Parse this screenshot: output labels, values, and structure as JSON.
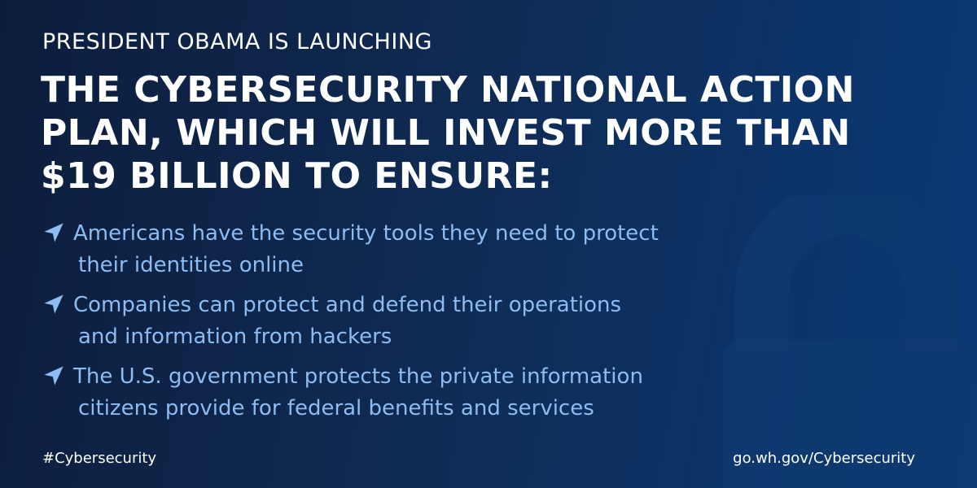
{
  "eyebrow": "PRESIDENT OBAMA IS LAUNCHING",
  "headline_lines": [
    "THE CYBERSECURITY NATIONAL ACTION",
    "PLAN, WHICH WILL INVEST MORE THAN",
    "$19 BILLION TO ENSURE:"
  ],
  "bullets": [
    {
      "icon": "navigation-arrow-icon",
      "lines": [
        "Americans have the security tools they need to protect",
        "their identities online"
      ]
    },
    {
      "icon": "navigation-arrow-icon",
      "lines": [
        "Companies can protect and defend their operations",
        "and information from hackers"
      ]
    },
    {
      "icon": "navigation-arrow-icon",
      "lines": [
        "The U.S. government protects the private information",
        "citizens provide for federal benefits and services"
      ]
    }
  ],
  "footer": {
    "hashtag": "#Cybersecurity",
    "url": "go.wh.gov/Cybersecurity"
  },
  "background_icon": "padlock-icon",
  "colors": {
    "background_dark": "#0c1d3c",
    "background_light": "#0a3a78",
    "headline": "#ffffff",
    "bullet_text": "#8cbcf2",
    "arrow": "#8cbcf2"
  }
}
